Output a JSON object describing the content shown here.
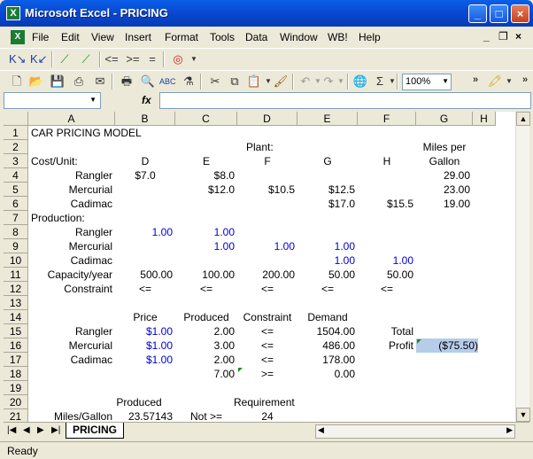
{
  "window": {
    "title": "Microsoft Excel - PRICING",
    "app_icon": "excel-icon"
  },
  "menu": [
    "File",
    "Edit",
    "View",
    "Insert",
    "Format",
    "Tools",
    "Data",
    "Window",
    "WB!",
    "Help"
  ],
  "toolbar": {
    "zoom": "100%"
  },
  "formula_bar": {
    "fx": "fx",
    "name_box": "",
    "content": ""
  },
  "columns": [
    "A",
    "B",
    "C",
    "D",
    "E",
    "F",
    "G",
    "H"
  ],
  "rows": [
    "1",
    "2",
    "3",
    "4",
    "5",
    "6",
    "7",
    "8",
    "9",
    "10",
    "11",
    "12",
    "13",
    "14",
    "15",
    "16",
    "17",
    "18",
    "19",
    "20",
    "21"
  ],
  "cells": {
    "A1": "CAR PRICING MODEL",
    "D2": "Plant:",
    "G2": "Miles per",
    "A3": "Cost/Unit:",
    "B3": "D",
    "C3": "E",
    "D3": "F",
    "E3": "G",
    "F3": "H",
    "G3": "Gallon",
    "A4": "Rangler",
    "B4": "$7.0",
    "C4": "$8.0",
    "G4": "29.00",
    "A5": "Mercurial",
    "C5": "$12.0",
    "D5": "$10.5",
    "E5": "$12.5",
    "G5": "23.00",
    "A6": "Cadimac",
    "E6": "$17.0",
    "F6": "$15.5",
    "G6": "19.00",
    "A7": "Production:",
    "A8": "Rangler",
    "B8": "1.00",
    "C8": "1.00",
    "A9": "Mercurial",
    "C9": "1.00",
    "D9": "1.00",
    "E9": "1.00",
    "A10": "Cadimac",
    "E10": "1.00",
    "F10": "1.00",
    "A11": "Capacity/year",
    "B11": "500.00",
    "C11": "100.00",
    "D11": "200.00",
    "E11": "50.00",
    "F11": "50.00",
    "A12": "Constraint",
    "B12": "<=",
    "C12": "<=",
    "D12": "<=",
    "E12": "<=",
    "F12": "<=",
    "B14": "Price",
    "C14": "Produced",
    "D14": "Constraint",
    "E14": "Demand",
    "A15": "Rangler",
    "B15": "$1.00",
    "C15": "2.00",
    "D15": "<=",
    "E15": "1504.00",
    "F15": "Total",
    "A16": "Mercurial",
    "B16": "$1.00",
    "C16": "3.00",
    "D16": "<=",
    "E16": "486.00",
    "F16": "Profit",
    "G16": "($75.50)",
    "A17": "Cadimac",
    "B17": "$1.00",
    "C17": "2.00",
    "D17": "<=",
    "E17": "178.00",
    "C18": "7.00",
    "D18": ">=",
    "E18": "0.00",
    "B20": "Produced",
    "D20": "Requirement",
    "A21": "Miles/Gallon",
    "B21": "23.57143",
    "C21": "Not >=",
    "D21": "24"
  },
  "sheet_tab": "PRICING",
  "status": "Ready"
}
